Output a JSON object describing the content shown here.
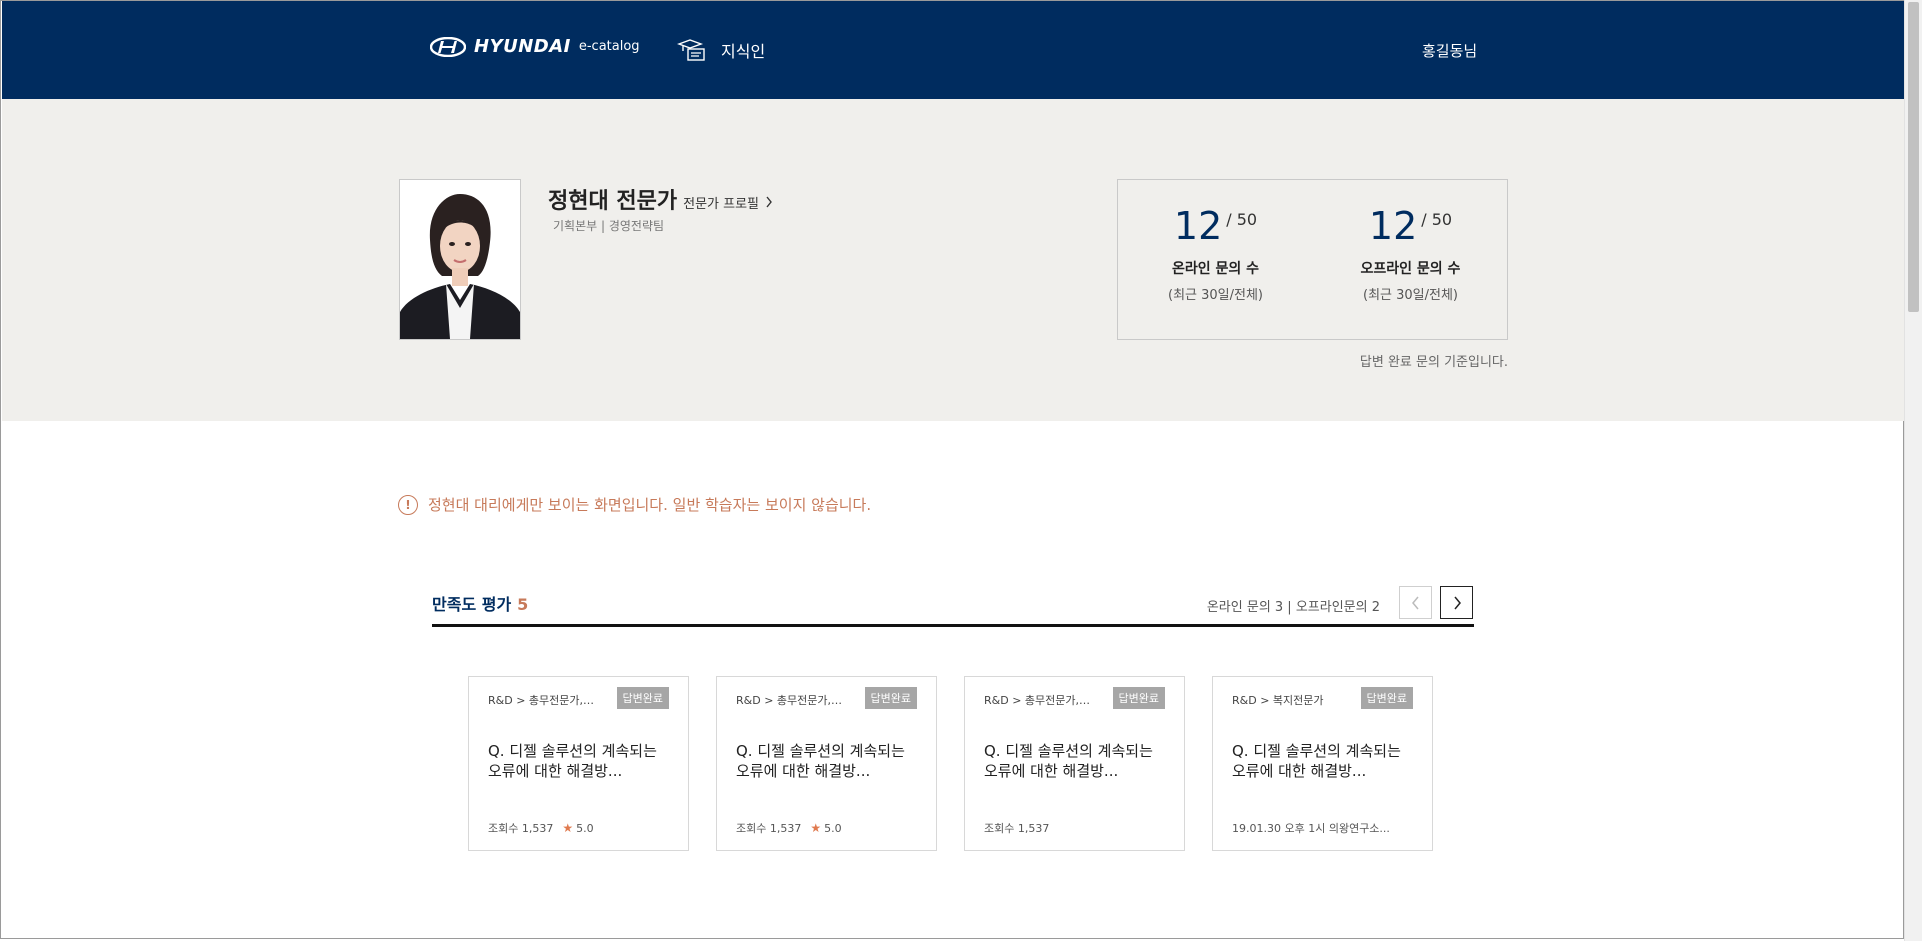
{
  "header": {
    "brand": "HYUNDAI",
    "brand_sub": "e-catalog",
    "nav_label": "지식인",
    "user_name": "홍길동님"
  },
  "profile": {
    "name": "정현대 전문가",
    "profile_link": "전문가 프로필",
    "department": "기획본부 | 경영전략팀"
  },
  "stats": {
    "online": {
      "count": "12",
      "total": "/ 50",
      "label": "온라인 문의 수",
      "sub": "(최근 30일/전체)"
    },
    "offline": {
      "count": "12",
      "total": "/ 50",
      "label": "오프라인 문의 수",
      "sub": "(최근 30일/전체)"
    },
    "note": "답변 완료 문의 기준입니다."
  },
  "notice": {
    "icon": "exclamation-circle-icon",
    "text": "정현대 대리에게만 보이는 화면입니다. 일반 학습자는 보이지 않습니다."
  },
  "section": {
    "title": "만족도 평가",
    "count": "5",
    "meta": "온라인 문의 3 | 오프라인문의 2"
  },
  "cards": [
    {
      "category": "R&D > 총무전문가,인사전문가",
      "badge": "답변완료",
      "question": "Q. 디젤 솔루션의 계속되는 오류에 대한 해결방...",
      "views": "조회수 1,537",
      "rating": "5.0"
    },
    {
      "category": "R&D > 총무전문가,인사전문가",
      "badge": "답변완료",
      "question": "Q. 디젤 솔루션의 계속되는 오류에 대한 해결방...",
      "views": "조회수 1,537",
      "rating": "5.0"
    },
    {
      "category": "R&D > 총무전문가,인사전문가",
      "badge": "답변완료",
      "question": "Q. 디젤 솔루션의 계속되는 오류에 대한 해결방...",
      "views": "조회수 1,537"
    },
    {
      "category": "R&D > 복지전문가",
      "badge": "답변완료",
      "question": "Q. 디젤 솔루션의 계속되는 오류에 대한 해결방...",
      "schedule": "19.01.30  오후 1시 의왕연구소..."
    }
  ],
  "colors": {
    "navy": "#002c5f",
    "accent": "#c77a5a",
    "band": "#f0efec",
    "badge": "#a6a6a6"
  }
}
